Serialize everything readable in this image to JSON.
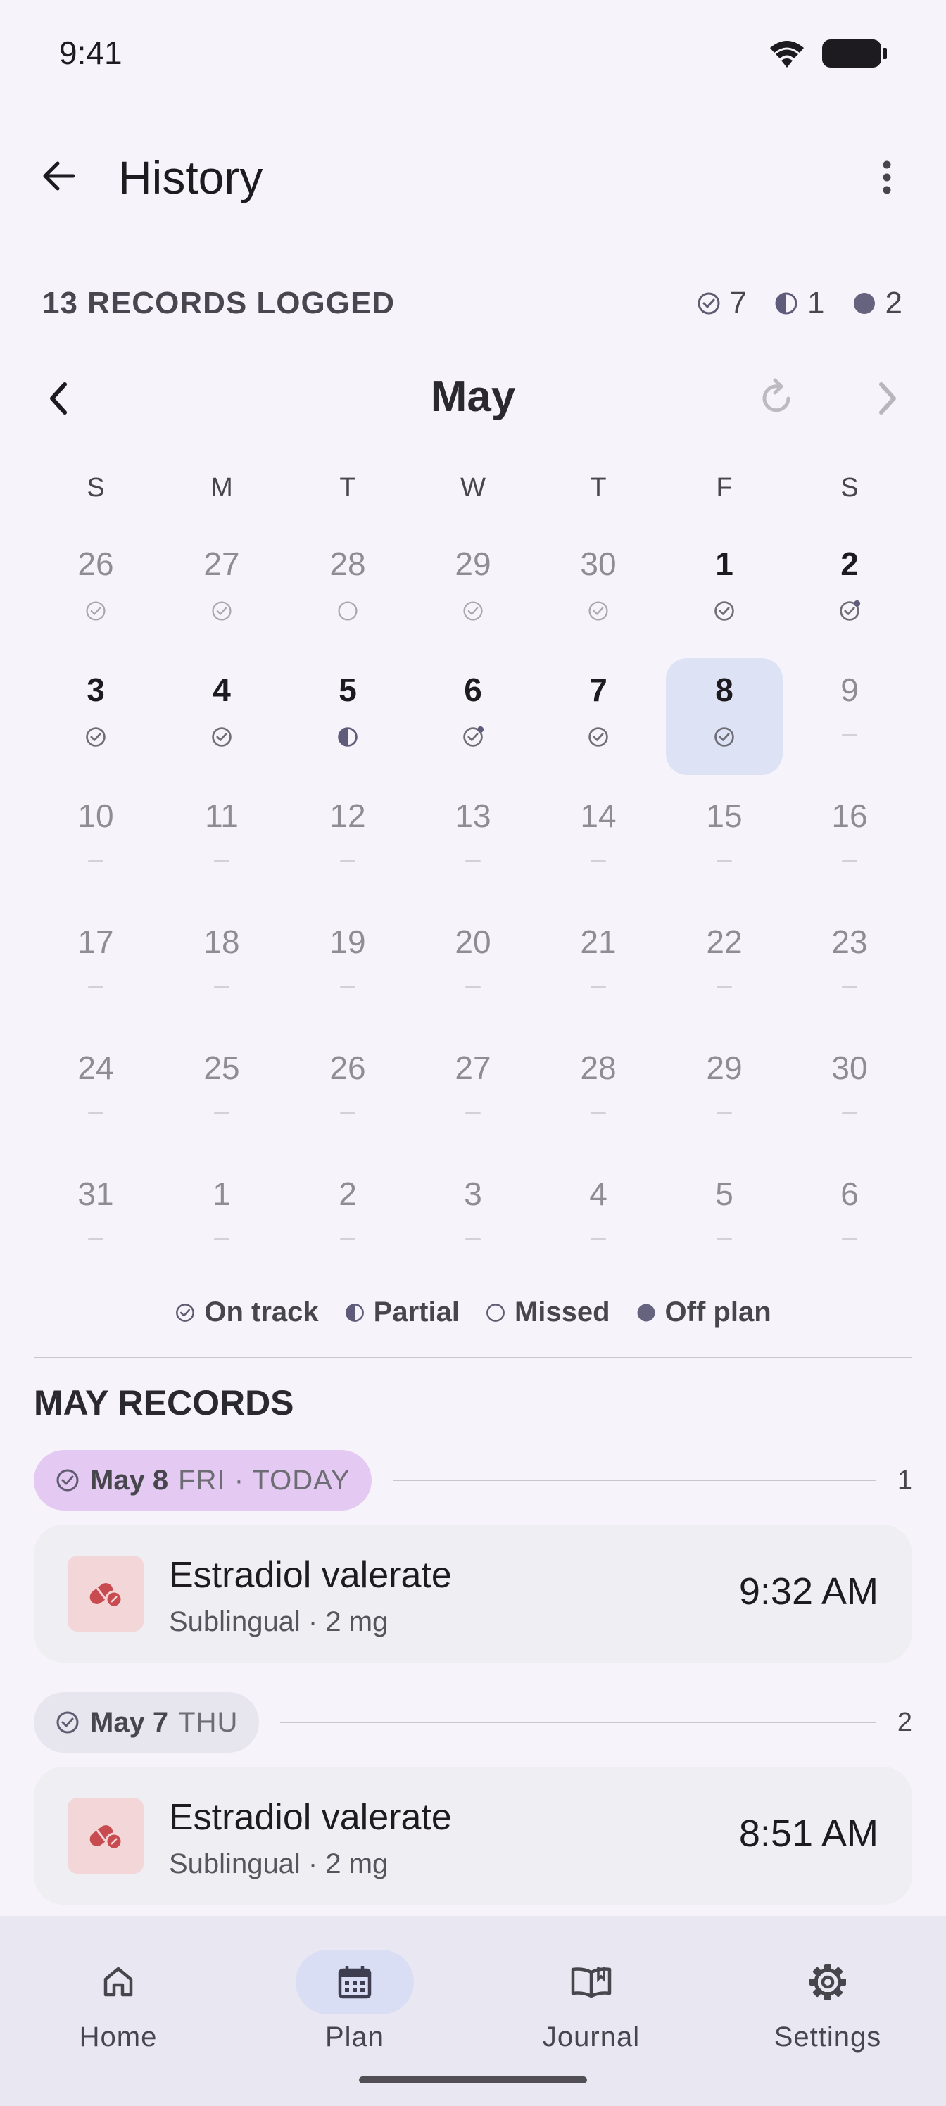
{
  "status_bar": {
    "time": "9:41"
  },
  "app_bar": {
    "title": "History"
  },
  "summary": {
    "records_logged": "13 RECORDS LOGGED",
    "on_track_count": "7",
    "partial_count": "1",
    "off_plan_count": "2"
  },
  "calendar": {
    "month": "May",
    "weekdays": [
      "S",
      "M",
      "T",
      "W",
      "T",
      "F",
      "S"
    ],
    "weeks": [
      [
        {
          "d": "26",
          "s": "check",
          "dim": true
        },
        {
          "d": "27",
          "s": "check",
          "dim": true
        },
        {
          "d": "28",
          "s": "missed",
          "dim": true
        },
        {
          "d": "29",
          "s": "check",
          "dim": true
        },
        {
          "d": "30",
          "s": "check",
          "dim": true
        },
        {
          "d": "1",
          "s": "check"
        },
        {
          "d": "2",
          "s": "check-dot"
        }
      ],
      [
        {
          "d": "3",
          "s": "check"
        },
        {
          "d": "4",
          "s": "check"
        },
        {
          "d": "5",
          "s": "partial"
        },
        {
          "d": "6",
          "s": "check-dot"
        },
        {
          "d": "7",
          "s": "check"
        },
        {
          "d": "8",
          "s": "check",
          "selected": true
        },
        {
          "d": "9",
          "s": "none",
          "dim": true
        }
      ],
      [
        {
          "d": "10",
          "s": "none",
          "dim": true
        },
        {
          "d": "11",
          "s": "none",
          "dim": true
        },
        {
          "d": "12",
          "s": "none",
          "dim": true
        },
        {
          "d": "13",
          "s": "none",
          "dim": true
        },
        {
          "d": "14",
          "s": "none",
          "dim": true
        },
        {
          "d": "15",
          "s": "none",
          "dim": true
        },
        {
          "d": "16",
          "s": "none",
          "dim": true
        }
      ],
      [
        {
          "d": "17",
          "s": "none",
          "dim": true
        },
        {
          "d": "18",
          "s": "none",
          "dim": true
        },
        {
          "d": "19",
          "s": "none",
          "dim": true
        },
        {
          "d": "20",
          "s": "none",
          "dim": true
        },
        {
          "d": "21",
          "s": "none",
          "dim": true
        },
        {
          "d": "22",
          "s": "none",
          "dim": true
        },
        {
          "d": "23",
          "s": "none",
          "dim": true
        }
      ],
      [
        {
          "d": "24",
          "s": "none",
          "dim": true
        },
        {
          "d": "25",
          "s": "none",
          "dim": true
        },
        {
          "d": "26",
          "s": "none",
          "dim": true
        },
        {
          "d": "27",
          "s": "none",
          "dim": true
        },
        {
          "d": "28",
          "s": "none",
          "dim": true
        },
        {
          "d": "29",
          "s": "none",
          "dim": true
        },
        {
          "d": "30",
          "s": "none",
          "dim": true
        }
      ],
      [
        {
          "d": "31",
          "s": "none",
          "dim": true
        },
        {
          "d": "1",
          "s": "none",
          "dim": true
        },
        {
          "d": "2",
          "s": "none",
          "dim": true
        },
        {
          "d": "3",
          "s": "none",
          "dim": true
        },
        {
          "d": "4",
          "s": "none",
          "dim": true
        },
        {
          "d": "5",
          "s": "none",
          "dim": true
        },
        {
          "d": "6",
          "s": "none",
          "dim": true
        }
      ]
    ]
  },
  "legend": {
    "on_track": "On track",
    "partial": "Partial",
    "missed": "Missed",
    "off_plan": "Off plan"
  },
  "records": {
    "section_title": "MAY RECORDS",
    "groups": [
      {
        "date": "May 8",
        "sub": "FRI · TODAY",
        "count": "1",
        "entry": {
          "name": "Estradiol valerate",
          "detail": "Sublingual · 2 mg",
          "time": "9:32 AM"
        }
      },
      {
        "date": "May 7",
        "sub": "THU",
        "count": "2",
        "entry": {
          "name": "Estradiol valerate",
          "detail": "Sublingual · 2 mg",
          "time": "8:51 AM"
        }
      }
    ]
  },
  "bottom_nav": {
    "home": "Home",
    "plan": "Plan",
    "journal": "Journal",
    "settings": "Settings"
  },
  "colors": {
    "accent": "#5f5b7a",
    "selected_day": "#dde3f5",
    "today_chip": "#e4c9f2",
    "chip": "#e7e6ee",
    "pill_bg": "#f3d6d8",
    "pill_icon": "#c74b4f"
  }
}
